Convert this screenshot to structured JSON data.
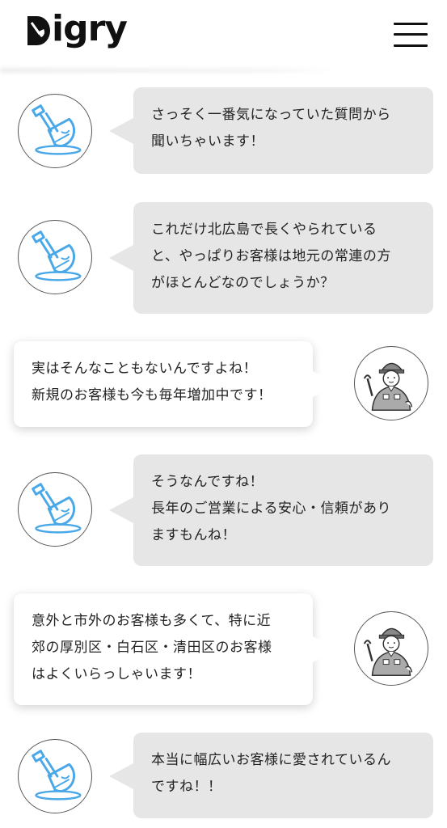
{
  "app": {
    "logo_text": "igry"
  },
  "messages": [
    {
      "speaker": "interviewer",
      "lines": [
        "さっそく一番気になっていた質問から",
        "聞いちゃいます！"
      ]
    },
    {
      "speaker": "interviewer",
      "lines": [
        "これだけ北広島で長くやられている",
        "と、やっぱりお客様は地元の常連の方",
        "がほとんどなのでしょうか？"
      ]
    },
    {
      "speaker": "staff",
      "lines": [
        "実はそんなこともないんですよね！",
        "新規のお客様も今も毎年増加中です！"
      ]
    },
    {
      "speaker": "interviewer",
      "lines": [
        "そうなんですね！",
        "長年のご営業による安心・信頼があり",
        "ますもんね！"
      ]
    },
    {
      "speaker": "staff",
      "lines": [
        "意外と市外のお客様も多くて、特に近",
        "郊の厚別区・白石区・清田区のお客様",
        "はよくいらっしゃいます！"
      ]
    },
    {
      "speaker": "interviewer",
      "lines": [
        "本当に幅広いお客様に愛されているん",
        "ですね！！"
      ]
    }
  ],
  "colors": {
    "shovel_blue": "#4aa8e8",
    "bubble_gray": "#e6e6e6"
  }
}
